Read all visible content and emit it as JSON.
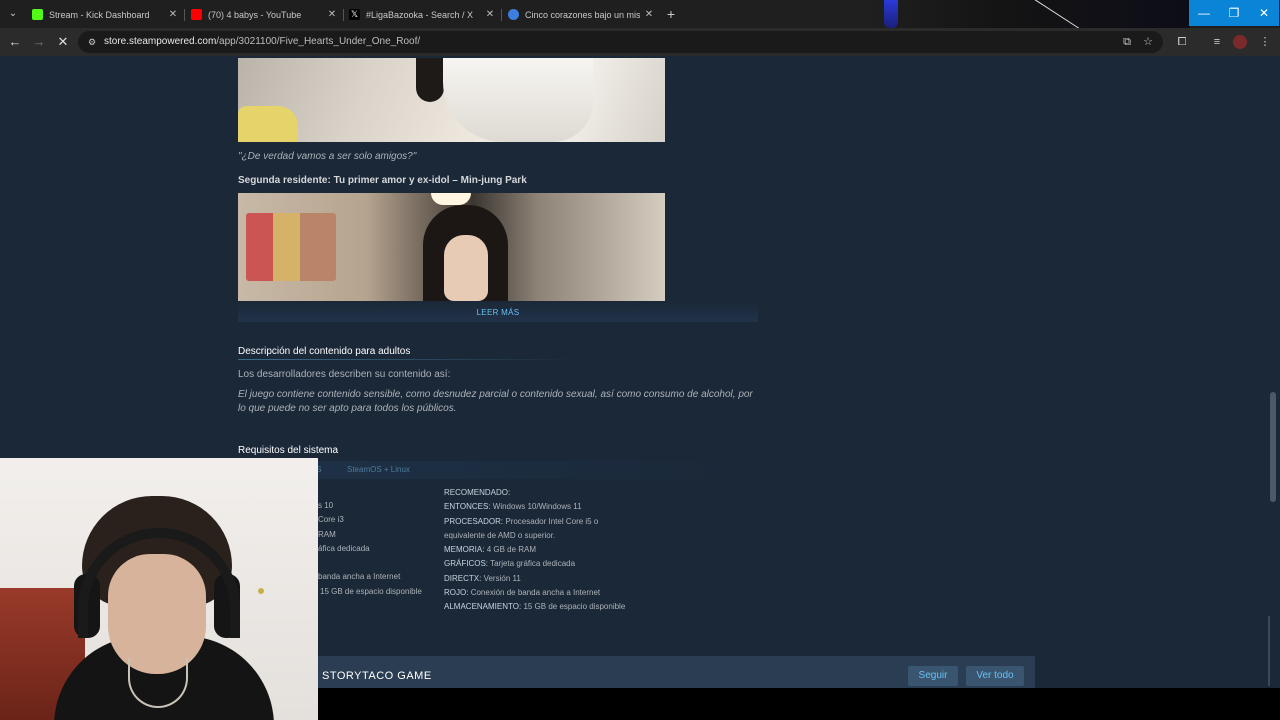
{
  "browser": {
    "tabs": [
      {
        "title": "Stream - Kick Dashboard",
        "favicon_color": "#53fc18"
      },
      {
        "title": "(70) 4 babys - YouTube",
        "favicon_color": "#ff0000"
      },
      {
        "title": "#LigaBazooka - Search / X",
        "favicon_color": "#000000"
      },
      {
        "title": "Cinco corazones bajo un mism",
        "favicon_color": "#3d7fe0"
      }
    ],
    "url_host": "store.steampowered.com",
    "url_path": "/app/3021100/Five_Hearts_Under_One_Roof/"
  },
  "content": {
    "quote": "\"¿De verdad vamos a ser solo amigos?\"",
    "second_resident": "Segunda residente: Tu primer amor y ex-idol – Min-jung Park",
    "read_more": "LEER MÁS"
  },
  "adult": {
    "heading": "Descripción del contenido para adultos",
    "intro": "Los desarrolladores describen su contenido así:",
    "description": "El juego contiene contenido sensible, como desnudez parcial o contenido sexual, así como consumo de alcohol, por lo que puede no ser apto para todos los públicos."
  },
  "requirements": {
    "heading": "Requisitos del sistema",
    "tabs": [
      "OS",
      "SteamOS + Linux"
    ],
    "minimum_partial": [
      "s 10",
      "Core i3",
      "RAM",
      "áfica dedicada",
      "",
      "banda ancha a Internet",
      "15 GB de espacio disponible"
    ],
    "recommended": {
      "title": "RECOMENDADO:",
      "rows": [
        {
          "label": "ENTONCES:",
          "value": "Windows 10/Windows 11"
        },
        {
          "label": "PROCESADOR:",
          "value": "Procesador Intel Core i5 o"
        },
        {
          "label": "",
          "value": "equivalente de AMD o superior."
        },
        {
          "label": "MEMORIA:",
          "value": "4 GB de RAM"
        },
        {
          "label": "GRÁFICOS:",
          "value": "Tarjeta gráfica dedicada"
        },
        {
          "label": "DIRECTX:",
          "value": "Versión 11"
        },
        {
          "label": "ROJO:",
          "value": "Conexión de banda ancha a Internet"
        },
        {
          "label": "ALMACENAMIENTO:",
          "value": "15 GB de espacio disponible"
        }
      ]
    }
  },
  "developer": {
    "name": "STORYTACO GAME",
    "follow_label": "Seguir",
    "view_all_label": "Ver todo"
  }
}
